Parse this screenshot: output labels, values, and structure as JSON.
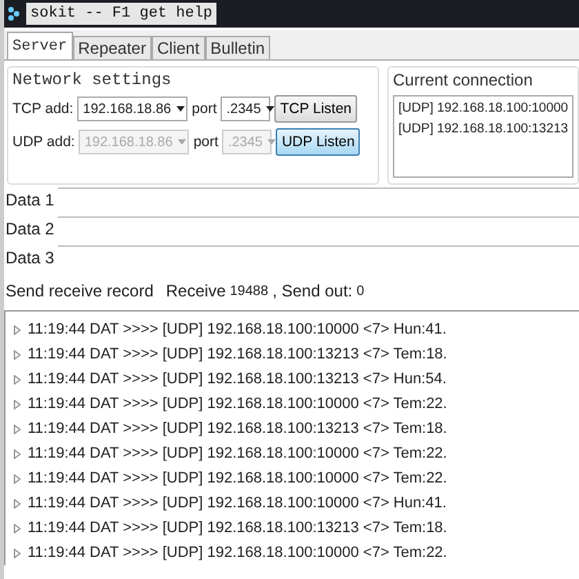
{
  "window": {
    "title": "sokit -- F1 get help"
  },
  "tabs": [
    {
      "label": "Server",
      "selected": true
    },
    {
      "label": "Repeater",
      "selected": false
    },
    {
      "label": "Client",
      "selected": false
    },
    {
      "label": "Bulletin",
      "selected": false
    }
  ],
  "network_settings": {
    "title": "Network settings",
    "rows": [
      {
        "label": "TCP add:",
        "address": "192.168.18.86",
        "port_label": "port",
        "port": ".2345",
        "button": "TCP Listen",
        "disabled": false,
        "on": false
      },
      {
        "label": "UDP add:",
        "address": "192.168.18.86",
        "port_label": "port",
        "port": ".2345",
        "button": "UDP Listen",
        "disabled": true,
        "on": true
      }
    ]
  },
  "current_connection": {
    "title": "Current connection",
    "items": [
      "[UDP] 192.168.18.100:10000",
      "[UDP] 192.168.18.100:13213"
    ]
  },
  "data_fields": [
    {
      "label": "Data 1"
    },
    {
      "label": "Data 2"
    },
    {
      "label": "Data 3"
    }
  ],
  "record": {
    "title": "Send receive record",
    "receive_label": "Receive",
    "receive": "19488",
    "send_label": ", Send out:",
    "send": "0"
  },
  "log": [
    "11:19:44 DAT >>>> [UDP] 192.168.18.100:10000 <7> Hun:41.",
    "11:19:44 DAT >>>> [UDP] 192.168.18.100:13213 <7> Tem:18.",
    "11:19:44 DAT >>>> [UDP] 192.168.18.100:13213 <7> Hun:54.",
    "11:19:44 DAT >>>> [UDP] 192.168.18.100:10000 <7> Tem:22.",
    "11:19:44 DAT >>>> [UDP] 192.168.18.100:13213 <7> Tem:18.",
    "11:19:44 DAT >>>> [UDP] 192.168.18.100:10000 <7> Tem:22.",
    "11:19:44 DAT >>>> [UDP] 192.168.18.100:10000 <7> Tem:22.",
    "11:19:44 DAT >>>> [UDP] 192.168.18.100:10000 <7> Hun:41.",
    "11:19:44 DAT >>>> [UDP] 192.168.18.100:13213 <7> Tem:18.",
    "11:19:44 DAT >>>> [UDP] 192.168.18.100:10000 <7> Tem:22."
  ]
}
